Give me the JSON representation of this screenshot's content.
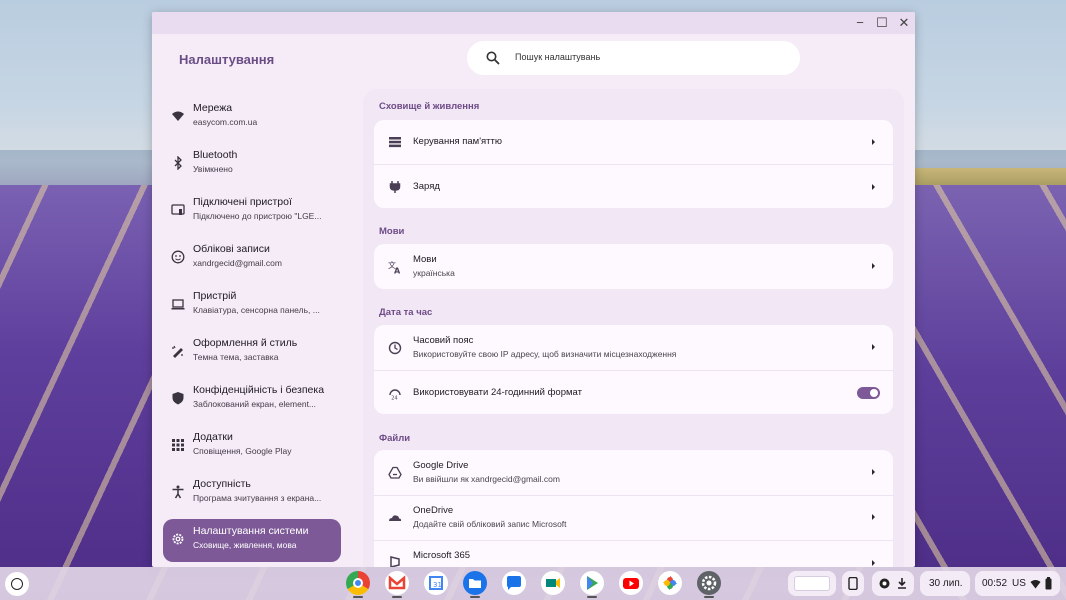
{
  "window": {
    "app_title": "Налаштування",
    "controls": {
      "minimize": "−",
      "maximize": "☐",
      "close": "✕"
    }
  },
  "search": {
    "placeholder": "Пошук налаштувань"
  },
  "sidebar": {
    "items": [
      {
        "label": "Мережа",
        "sub": "easycom.com.ua",
        "icon": "wifi-icon"
      },
      {
        "label": "Bluetooth",
        "sub": "Увімкнено",
        "icon": "bluetooth-icon"
      },
      {
        "label": "Підключені пристрої",
        "sub": "Підключено до пристрою \"LGE...",
        "icon": "connected-devices-icon"
      },
      {
        "label": "Облікові записи",
        "sub": "xandrgecid@gmail.com",
        "icon": "account-icon"
      },
      {
        "label": "Пристрій",
        "sub": "Клавіатура, сенсорна панель, ...",
        "icon": "laptop-icon"
      },
      {
        "label": "Оформлення й стиль",
        "sub": "Темна тема, заставка",
        "icon": "palette-icon"
      },
      {
        "label": "Конфіденційність і безпека",
        "sub": "Заблокований екран, element...",
        "icon": "shield-icon"
      },
      {
        "label": "Додатки",
        "sub": "Сповіщення, Google Play",
        "icon": "apps-grid-icon"
      },
      {
        "label": "Доступність",
        "sub": "Програма зчитування з екрана...",
        "icon": "accessibility-icon"
      },
      {
        "label": "Налаштування системи",
        "sub": "Сховище, живлення, мова",
        "icon": "gear-icon",
        "active": true
      }
    ]
  },
  "main": {
    "storage": {
      "title": "Сховище й живлення",
      "rows": [
        {
          "label": "Керування пам'яттю",
          "icon": "storage-icon"
        },
        {
          "label": "Заряд",
          "icon": "power-plug-icon"
        }
      ]
    },
    "languages": {
      "title": "Мови",
      "rows": [
        {
          "label": "Мови",
          "sub": "українська",
          "icon": "translate-icon"
        }
      ]
    },
    "datetime": {
      "title": "Дата та час",
      "rows": [
        {
          "label": "Часовий пояс",
          "sub": "Використовуйте свою IP адресу, щоб визначити місцезнаходження",
          "icon": "clock-icon"
        },
        {
          "label": "Використовувати 24-годинний формат",
          "icon": "time-format-icon",
          "toggle_on": true
        }
      ]
    },
    "files": {
      "title": "Файли",
      "rows": [
        {
          "label": "Google Drive",
          "sub": "Ви ввійшли як xandrgecid@gmail.com",
          "icon": "google-drive-icon"
        },
        {
          "label": "OneDrive",
          "sub": "Додайте свій обліковий запис Microsoft",
          "icon": "onedrive-icon"
        },
        {
          "label": "Microsoft 365",
          "icon": "microsoft-365-icon"
        }
      ]
    }
  },
  "shelf": {
    "apps": [
      "chrome-icon",
      "gmail-icon",
      "calendar-icon",
      "files-icon",
      "messages-icon",
      "meet-icon",
      "play-store-icon",
      "youtube-icon",
      "photos-icon",
      "settings-icon"
    ],
    "date": "30 лип.",
    "time": "00:52",
    "keyboard": "US"
  },
  "colors": {
    "accent": "#7d5a97",
    "window_bg": "#f5ecf7",
    "card_bg": "#fdf9fe"
  }
}
